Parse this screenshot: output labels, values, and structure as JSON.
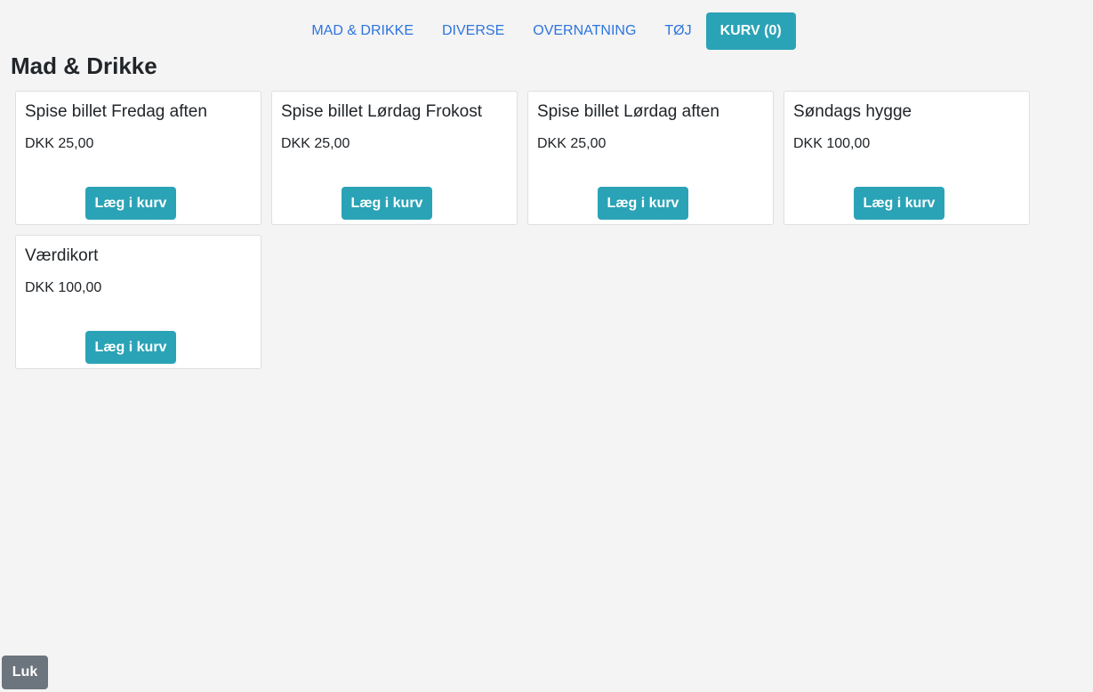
{
  "nav": {
    "items": [
      {
        "label": "MAD & DRIKKE"
      },
      {
        "label": "DIVERSE"
      },
      {
        "label": "OVERNATNING"
      },
      {
        "label": "TØJ"
      }
    ],
    "cart_label": "KURV (0)"
  },
  "main": {
    "title": "Mad & Drikke",
    "products": [
      {
        "name": "Spise billet Fredag aften",
        "price": "DKK 25,00",
        "button": "Læg i kurv"
      },
      {
        "name": "Spise billet Lørdag Frokost",
        "price": "DKK 25,00",
        "button": "Læg i kurv"
      },
      {
        "name": "Spise billet Lørdag aften",
        "price": "DKK 25,00",
        "button": "Læg i kurv"
      },
      {
        "name": "Søndags hygge",
        "price": "DKK 100,00",
        "button": "Læg i kurv"
      },
      {
        "name": "Værdikort",
        "price": "DKK 100,00",
        "button": "Læg i kurv"
      }
    ]
  },
  "footer": {
    "close_label": "Luk"
  },
  "colors": {
    "accent": "#2ba3b6",
    "link": "#2d74e0",
    "background": "#f4f4f4",
    "secondary_button": "#6c757d"
  }
}
